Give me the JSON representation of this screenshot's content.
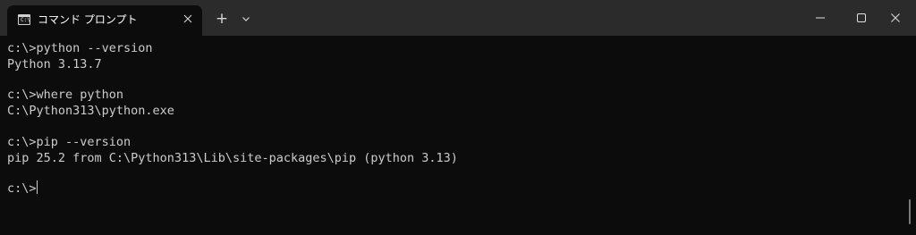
{
  "tab": {
    "title": "コマンド プロンプト",
    "icon": "cmd-icon",
    "icon_glyph": "C:\\",
    "close_icon": "close-icon"
  },
  "titlebar": {
    "new_tab_glyph": "+",
    "controls": [
      "minimize-icon",
      "maximize-icon",
      "close-icon"
    ]
  },
  "terminal": {
    "lines": [
      "c:\\>python --version",
      "Python 3.13.7",
      "",
      "c:\\>where python",
      "C:\\Python313\\python.exe",
      "",
      "c:\\>pip --version",
      "pip 25.2 from C:\\Python313\\Lib\\site-packages\\pip (python 3.13)",
      "",
      "c:\\>"
    ]
  },
  "colors": {
    "background": "#0c0c0c",
    "titlebar": "#2b2b2b",
    "text": "#cccccc"
  }
}
